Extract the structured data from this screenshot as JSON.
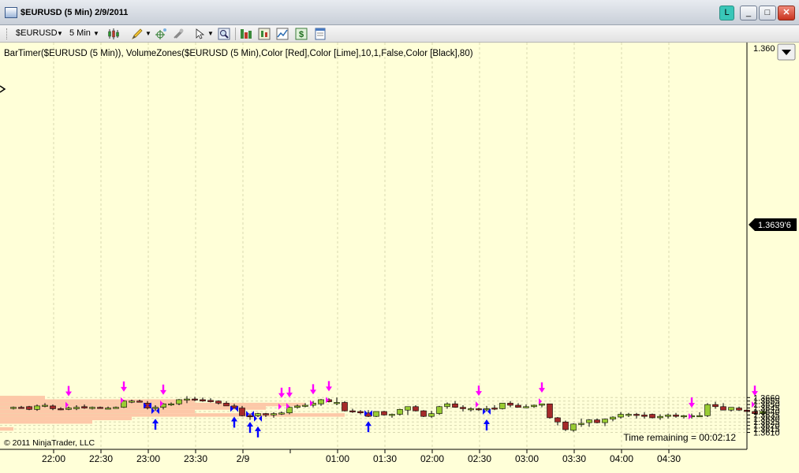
{
  "window": {
    "title": "$EURUSD (5 Min)  2/9/2011",
    "buttons": {
      "link": "L",
      "minimize": "_",
      "maximize": "□",
      "close": "✕"
    }
  },
  "toolbar": {
    "instrument": "$EURUSD",
    "interval": "5 Min",
    "icons": [
      "candlestick-icon",
      "pencil-icon",
      "crosshair-icon",
      "magnet-icon",
      "pointer-icon",
      "zoom-icon",
      "bar-chart-icon",
      "indicator-icon",
      "strategy-icon",
      "dollar-icon",
      "properties-icon"
    ]
  },
  "chart": {
    "indicator_label": "BarTimer($EURUSD (5 Min)), VolumeZones($EURUSD (5 Min),Color [Red],Color [Lime],10,1,False,Color [Black],80)",
    "copyright": "© 2011 NinjaTrader, LLC",
    "time_remaining": "Time remaining = 00:02:12",
    "current_price": "1.3639'6",
    "colors": {
      "background": "#ffffd8",
      "up": "#99cc33",
      "down": "#a52a2a",
      "sell_arrow": "#ff00ff",
      "buy_arrow": "#0000ff",
      "red_zone": "#fdc8a8",
      "green_zone": "#c8f8a8"
    }
  },
  "chart_data": {
    "type": "candlestick",
    "ylim": [
      1.3607,
      1.3662
    ],
    "y_ticks": [
      "1.3610",
      "1.3615",
      "1.3620",
      "1.3625",
      "1.3630",
      "1.3635",
      "1.3640",
      "1.3645",
      "1.3650",
      "1.3655",
      "1.3660"
    ],
    "y_tick_top_partial": "1.360",
    "x_ticks": [
      "22:00",
      "22:30",
      "23:00",
      "23:30",
      "2/9",
      "01:00",
      "01:30",
      "02:00",
      "02:30",
      "03:00",
      "03:30",
      "04:00",
      "04:30"
    ],
    "candles": [
      {
        "o": 1.3645,
        "h": 1.3647,
        "l": 1.3643,
        "c": 1.3646
      },
      {
        "o": 1.3646,
        "h": 1.3648,
        "l": 1.3644,
        "c": 1.3645
      },
      {
        "o": 1.3647,
        "h": 1.3648,
        "l": 1.3642,
        "c": 1.3643
      },
      {
        "o": 1.3643,
        "h": 1.365,
        "l": 1.3641,
        "c": 1.3648
      },
      {
        "o": 1.3648,
        "h": 1.3652,
        "l": 1.3646,
        "c": 1.3649
      },
      {
        "o": 1.3648,
        "h": 1.365,
        "l": 1.3642,
        "c": 1.3644
      },
      {
        "o": 1.3644,
        "h": 1.3646,
        "l": 1.3642,
        "c": 1.3643
      },
      {
        "o": 1.3643,
        "h": 1.3647,
        "l": 1.3642,
        "c": 1.3645
      },
      {
        "o": 1.3644,
        "h": 1.3649,
        "l": 1.3642,
        "c": 1.3646
      },
      {
        "o": 1.3647,
        "h": 1.365,
        "l": 1.3644,
        "c": 1.3645
      },
      {
        "o": 1.3645,
        "h": 1.3647,
        "l": 1.3643,
        "c": 1.3646
      },
      {
        "o": 1.3646,
        "h": 1.3647,
        "l": 1.3644,
        "c": 1.3645
      },
      {
        "o": 1.3645,
        "h": 1.3647,
        "l": 1.3644,
        "c": 1.3645
      },
      {
        "o": 1.3645,
        "h": 1.3647,
        "l": 1.3644,
        "c": 1.3646
      },
      {
        "o": 1.3646,
        "h": 1.3656,
        "l": 1.3645,
        "c": 1.3655
      },
      {
        "o": 1.3654,
        "h": 1.3657,
        "l": 1.3652,
        "c": 1.3655
      },
      {
        "o": 1.3655,
        "h": 1.3657,
        "l": 1.3653,
        "c": 1.3654
      },
      {
        "o": 1.3652,
        "h": 1.3655,
        "l": 1.3643,
        "c": 1.3645
      },
      {
        "o": 1.3645,
        "h": 1.3649,
        "l": 1.3641,
        "c": 1.3646
      },
      {
        "o": 1.3646,
        "h": 1.3652,
        "l": 1.3643,
        "c": 1.3651
      },
      {
        "o": 1.365,
        "h": 1.3653,
        "l": 1.3648,
        "c": 1.3651
      },
      {
        "o": 1.3651,
        "h": 1.3658,
        "l": 1.3649,
        "c": 1.3657
      },
      {
        "o": 1.3657,
        "h": 1.3662,
        "l": 1.3652,
        "c": 1.3658
      },
      {
        "o": 1.3658,
        "h": 1.3661,
        "l": 1.3655,
        "c": 1.3657
      },
      {
        "o": 1.3657,
        "h": 1.366,
        "l": 1.3654,
        "c": 1.3655
      },
      {
        "o": 1.3656,
        "h": 1.3659,
        "l": 1.3653,
        "c": 1.3654
      },
      {
        "o": 1.3655,
        "h": 1.3656,
        "l": 1.365,
        "c": 1.3652
      },
      {
        "o": 1.3652,
        "h": 1.3655,
        "l": 1.3648,
        "c": 1.3648
      },
      {
        "o": 1.3648,
        "h": 1.3651,
        "l": 1.3644,
        "c": 1.3645
      },
      {
        "o": 1.3645,
        "h": 1.3648,
        "l": 1.3633,
        "c": 1.3634
      },
      {
        "o": 1.3634,
        "h": 1.3637,
        "l": 1.3628,
        "c": 1.3633
      },
      {
        "o": 1.3634,
        "h": 1.3638,
        "l": 1.3632,
        "c": 1.3637
      },
      {
        "o": 1.3637,
        "h": 1.3638,
        "l": 1.3632,
        "c": 1.3635
      },
      {
        "o": 1.3635,
        "h": 1.3639,
        "l": 1.3631,
        "c": 1.3637
      },
      {
        "o": 1.3637,
        "h": 1.364,
        "l": 1.3635,
        "c": 1.3638
      },
      {
        "o": 1.3638,
        "h": 1.3647,
        "l": 1.3636,
        "c": 1.3646
      },
      {
        "o": 1.3646,
        "h": 1.365,
        "l": 1.3644,
        "c": 1.3648
      },
      {
        "o": 1.3648,
        "h": 1.3652,
        "l": 1.3646,
        "c": 1.3649
      },
      {
        "o": 1.3649,
        "h": 1.3655,
        "l": 1.3646,
        "c": 1.3652
      },
      {
        "o": 1.3651,
        "h": 1.3658,
        "l": 1.3648,
        "c": 1.3657
      },
      {
        "o": 1.3657,
        "h": 1.3659,
        "l": 1.3653,
        "c": 1.3654
      },
      {
        "o": 1.3652,
        "h": 1.366,
        "l": 1.3649,
        "c": 1.3653
      },
      {
        "o": 1.3653,
        "h": 1.3655,
        "l": 1.364,
        "c": 1.3641
      },
      {
        "o": 1.3641,
        "h": 1.3644,
        "l": 1.3638,
        "c": 1.364
      },
      {
        "o": 1.364,
        "h": 1.3642,
        "l": 1.3636,
        "c": 1.3638
      },
      {
        "o": 1.3638,
        "h": 1.3642,
        "l": 1.3632,
        "c": 1.3633
      },
      {
        "o": 1.3633,
        "h": 1.364,
        "l": 1.3632,
        "c": 1.364
      },
      {
        "o": 1.364,
        "h": 1.3641,
        "l": 1.3634,
        "c": 1.3635
      },
      {
        "o": 1.3635,
        "h": 1.3637,
        "l": 1.3631,
        "c": 1.3636
      },
      {
        "o": 1.3636,
        "h": 1.3644,
        "l": 1.3634,
        "c": 1.3643
      },
      {
        "o": 1.3642,
        "h": 1.3647,
        "l": 1.3635,
        "c": 1.3647
      },
      {
        "o": 1.3647,
        "h": 1.3649,
        "l": 1.364,
        "c": 1.3641
      },
      {
        "o": 1.3641,
        "h": 1.3642,
        "l": 1.3632,
        "c": 1.3633
      },
      {
        "o": 1.3633,
        "h": 1.3641,
        "l": 1.3631,
        "c": 1.3637
      },
      {
        "o": 1.3637,
        "h": 1.3648,
        "l": 1.3635,
        "c": 1.3647
      },
      {
        "o": 1.3647,
        "h": 1.3653,
        "l": 1.3644,
        "c": 1.3651
      },
      {
        "o": 1.3651,
        "h": 1.3655,
        "l": 1.3646,
        "c": 1.3646
      },
      {
        "o": 1.3646,
        "h": 1.3649,
        "l": 1.364,
        "c": 1.3644
      },
      {
        "o": 1.3644,
        "h": 1.3646,
        "l": 1.364,
        "c": 1.3644
      },
      {
        "o": 1.3644,
        "h": 1.3645,
        "l": 1.3641,
        "c": 1.3643
      },
      {
        "o": 1.3643,
        "h": 1.3648,
        "l": 1.364,
        "c": 1.3644
      },
      {
        "o": 1.3645,
        "h": 1.3649,
        "l": 1.3642,
        "c": 1.3644
      },
      {
        "o": 1.3644,
        "h": 1.3652,
        "l": 1.3643,
        "c": 1.3652
      },
      {
        "o": 1.3652,
        "h": 1.3655,
        "l": 1.3646,
        "c": 1.3649
      },
      {
        "o": 1.3649,
        "h": 1.3652,
        "l": 1.3646,
        "c": 1.3646
      },
      {
        "o": 1.3647,
        "h": 1.365,
        "l": 1.3645,
        "c": 1.3647
      },
      {
        "o": 1.3647,
        "h": 1.365,
        "l": 1.3645,
        "c": 1.3649
      },
      {
        "o": 1.3649,
        "h": 1.3651,
        "l": 1.3646,
        "c": 1.3651
      },
      {
        "o": 1.3651,
        "h": 1.3651,
        "l": 1.363,
        "c": 1.3631
      },
      {
        "o": 1.3631,
        "h": 1.3632,
        "l": 1.362,
        "c": 1.3625
      },
      {
        "o": 1.3625,
        "h": 1.3627,
        "l": 1.3612,
        "c": 1.3614
      },
      {
        "o": 1.3613,
        "h": 1.3623,
        "l": 1.3611,
        "c": 1.3622
      },
      {
        "o": 1.3622,
        "h": 1.363,
        "l": 1.3618,
        "c": 1.3623
      },
      {
        "o": 1.3624,
        "h": 1.3629,
        "l": 1.3618,
        "c": 1.3628
      },
      {
        "o": 1.3628,
        "h": 1.363,
        "l": 1.3623,
        "c": 1.3624
      },
      {
        "o": 1.3624,
        "h": 1.363,
        "l": 1.3619,
        "c": 1.3629
      },
      {
        "o": 1.3629,
        "h": 1.3633,
        "l": 1.3626,
        "c": 1.3632
      },
      {
        "o": 1.3632,
        "h": 1.3639,
        "l": 1.363,
        "c": 1.3636
      },
      {
        "o": 1.3635,
        "h": 1.3638,
        "l": 1.3632,
        "c": 1.3636
      },
      {
        "o": 1.3636,
        "h": 1.3638,
        "l": 1.363,
        "c": 1.3635
      },
      {
        "o": 1.3635,
        "h": 1.3639,
        "l": 1.363,
        "c": 1.3633
      },
      {
        "o": 1.3636,
        "h": 1.3637,
        "l": 1.363,
        "c": 1.3631
      },
      {
        "o": 1.3631,
        "h": 1.3636,
        "l": 1.3628,
        "c": 1.3633
      },
      {
        "o": 1.3633,
        "h": 1.3637,
        "l": 1.363,
        "c": 1.3635
      },
      {
        "o": 1.3635,
        "h": 1.3638,
        "l": 1.3631,
        "c": 1.3633
      },
      {
        "o": 1.3633,
        "h": 1.3635,
        "l": 1.363,
        "c": 1.3634
      },
      {
        "o": 1.3634,
        "h": 1.3637,
        "l": 1.363,
        "c": 1.3634
      },
      {
        "o": 1.3634,
        "h": 1.3639,
        "l": 1.3632,
        "c": 1.3634
      },
      {
        "o": 1.3634,
        "h": 1.3652,
        "l": 1.3632,
        "c": 1.365
      },
      {
        "o": 1.365,
        "h": 1.3654,
        "l": 1.3644,
        "c": 1.3647
      },
      {
        "o": 1.3647,
        "h": 1.3652,
        "l": 1.3643,
        "c": 1.3642
      },
      {
        "o": 1.3642,
        "h": 1.3646,
        "l": 1.364,
        "c": 1.3646
      },
      {
        "o": 1.3645,
        "h": 1.3647,
        "l": 1.3641,
        "c": 1.3642
      },
      {
        "o": 1.3642,
        "h": 1.3643,
        "l": 1.3639,
        "c": 1.364
      },
      {
        "o": 1.364,
        "h": 1.364,
        "l": 1.3636,
        "c": 1.3637
      },
      {
        "o": 1.3637,
        "h": 1.3641,
        "l": 1.3636,
        "c": 1.364
      }
    ],
    "volume_zones": [
      {
        "side": "green",
        "lo": 1.36575,
        "hi": 1.36625,
        "right_time": "21:50"
      },
      {
        "side": "red",
        "lo": 1.36575,
        "hi": 1.36625,
        "right_time": "22:05"
      },
      {
        "side": "green",
        "lo": 1.36525,
        "hi": 1.36575,
        "right_time": "22:40"
      },
      {
        "side": "red",
        "lo": 1.36525,
        "hi": 1.36575,
        "right_time": "23:40"
      },
      {
        "side": "green",
        "lo": 1.36475,
        "hi": 1.36525,
        "right_time": "00:25"
      },
      {
        "side": "red",
        "lo": 1.36475,
        "hi": 1.36525,
        "right_time": "00:50"
      },
      {
        "side": "green",
        "lo": 1.36425,
        "hi": 1.36475,
        "right_time": "22:50"
      },
      {
        "side": "red",
        "lo": 1.36425,
        "hi": 1.36475,
        "right_time": "00:25"
      },
      {
        "side": "green",
        "lo": 1.36375,
        "hi": 1.36425,
        "right_time": "23:05"
      },
      {
        "side": "red",
        "lo": 1.36375,
        "hi": 1.36425,
        "right_time": "23:40"
      },
      {
        "side": "green",
        "lo": 1.36325,
        "hi": 1.36375,
        "right_time": "23:05"
      },
      {
        "side": "red",
        "lo": 1.36325,
        "hi": 1.36375,
        "right_time": "01:15"
      },
      {
        "side": "green",
        "lo": 1.36275,
        "hi": 1.36325,
        "right_time": "22:05"
      },
      {
        "side": "red",
        "lo": 1.36275,
        "hi": 1.36325,
        "right_time": "23:00"
      },
      {
        "side": "green",
        "lo": 1.36225,
        "hi": 1.36275,
        "right_time": "22:05"
      },
      {
        "side": "red",
        "lo": 1.36225,
        "hi": 1.36275,
        "right_time": "22:35"
      },
      {
        "side": "red",
        "lo": 1.36125,
        "hi": 1.36175,
        "right_time": "21:45"
      }
    ],
    "sell_arrows": [
      {
        "i": 7,
        "y": 1.36495,
        "tag": true
      },
      {
        "i": 14,
        "y": 1.3656,
        "tag": true
      },
      {
        "i": 19,
        "y": 1.36515,
        "tag": true
      },
      {
        "i": 34,
        "y": 1.3647,
        "tag": true
      },
      {
        "i": 35,
        "y": 1.36478,
        "tag": true
      },
      {
        "i": 38,
        "y": 1.3652,
        "tag": true
      },
      {
        "i": 40,
        "y": 1.36565,
        "tag": true
      },
      {
        "i": 59,
        "y": 1.365,
        "tag": true
      },
      {
        "i": 67,
        "y": 1.36546,
        "tag": true
      },
      {
        "i": 86,
        "y": 1.3633,
        "tag": true
      },
      {
        "i": 94,
        "y": 1.365,
        "tag": true
      }
    ],
    "buy_arrows": [
      {
        "i": 18,
        "y": 1.3641,
        "tag": true
      },
      {
        "i": 17,
        "y": 1.36485,
        "tag": false
      },
      {
        "i": 28,
        "y": 1.3644,
        "tag": true
      },
      {
        "i": 30,
        "y": 1.36365,
        "tag": true
      },
      {
        "i": 31,
        "y": 1.363,
        "tag": true
      },
      {
        "i": 45,
        "y": 1.36375,
        "tag": true
      },
      {
        "i": 60,
        "y": 1.364,
        "tag": true
      },
      {
        "i": 101,
        "y": 1.3633,
        "tag": true
      }
    ]
  }
}
